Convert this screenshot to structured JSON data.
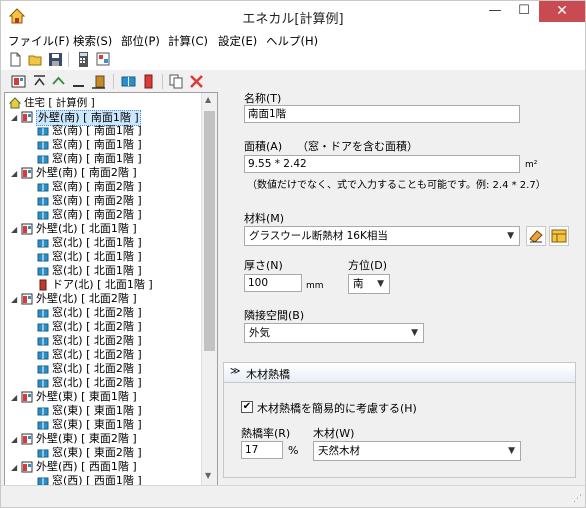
{
  "window": {
    "title": "エネカル[計算例]",
    "min": "—",
    "max": "☐",
    "close": "✕"
  },
  "menu": [
    "ファイル(F)",
    "検索(S)",
    "部位(P)",
    "計算(C)",
    "設定(E)",
    "ヘルプ(H)"
  ],
  "tree": {
    "root": "住宅 [ 計算例 ]",
    "rows": [
      {
        "label": "外壁(南) [ 南面1階 ]",
        "level": 1,
        "kind": "wall",
        "selected": true
      },
      {
        "label": "窓(南) [ 南面1階 ]",
        "level": 2,
        "kind": "window"
      },
      {
        "label": "窓(南) [ 南面1階 ]",
        "level": 2,
        "kind": "window"
      },
      {
        "label": "窓(南) [ 南面1階 ]",
        "level": 2,
        "kind": "window"
      },
      {
        "label": "外壁(南) [ 南面2階 ]",
        "level": 1,
        "kind": "wall"
      },
      {
        "label": "窓(南) [ 南面2階 ]",
        "level": 2,
        "kind": "window"
      },
      {
        "label": "窓(南) [ 南面2階 ]",
        "level": 2,
        "kind": "window"
      },
      {
        "label": "窓(南) [ 南面2階 ]",
        "level": 2,
        "kind": "window"
      },
      {
        "label": "外壁(北) [ 北面1階 ]",
        "level": 1,
        "kind": "wall"
      },
      {
        "label": "窓(北) [ 北面1階 ]",
        "level": 2,
        "kind": "window"
      },
      {
        "label": "窓(北) [ 北面1階 ]",
        "level": 2,
        "kind": "window"
      },
      {
        "label": "窓(北) [ 北面1階 ]",
        "level": 2,
        "kind": "window"
      },
      {
        "label": "ドア(北) [ 北面1階 ]",
        "level": 2,
        "kind": "door"
      },
      {
        "label": "外壁(北) [ 北面2階 ]",
        "level": 1,
        "kind": "wall"
      },
      {
        "label": "窓(北) [ 北面2階 ]",
        "level": 2,
        "kind": "window"
      },
      {
        "label": "窓(北) [ 北面2階 ]",
        "level": 2,
        "kind": "window"
      },
      {
        "label": "窓(北) [ 北面2階 ]",
        "level": 2,
        "kind": "window"
      },
      {
        "label": "窓(北) [ 北面2階 ]",
        "level": 2,
        "kind": "window"
      },
      {
        "label": "窓(北) [ 北面2階 ]",
        "level": 2,
        "kind": "window"
      },
      {
        "label": "窓(北) [ 北面2階 ]",
        "level": 2,
        "kind": "window"
      },
      {
        "label": "外壁(東) [ 東面1階 ]",
        "level": 1,
        "kind": "wall"
      },
      {
        "label": "窓(東) [ 東面1階 ]",
        "level": 2,
        "kind": "window"
      },
      {
        "label": "窓(東) [ 東面1階 ]",
        "level": 2,
        "kind": "window"
      },
      {
        "label": "外壁(東) [ 東面2階 ]",
        "level": 1,
        "kind": "wall"
      },
      {
        "label": "窓(東) [ 東面2階 ]",
        "level": 2,
        "kind": "window"
      },
      {
        "label": "外壁(西) [ 西面1階 ]",
        "level": 1,
        "kind": "wall"
      },
      {
        "label": "窓(西) [ 西面1階 ]",
        "level": 2,
        "kind": "window"
      }
    ]
  },
  "form": {
    "name_label": "名称(T)",
    "name_value": "南面1階",
    "area_label": "面積(A)",
    "area_hint": "（窓・ドアを含む面積）",
    "area_value": "9.55 * 2.42",
    "area_unit": "m²",
    "area_note": "（数値だけでなく、式で入力することも可能です。例: 2.4 * 2.7）",
    "material_label": "材料(M)",
    "material_value": "グラスウール断熱材 16K相当",
    "thickness_label": "厚さ(N)",
    "thickness_value": "100",
    "thickness_unit": "mm",
    "direction_label": "方位(D)",
    "direction_value": "南",
    "adjacent_label": "隣接空間(B)",
    "adjacent_value": "外気"
  },
  "wood_group": {
    "header": "木材熱橋",
    "checkbox_label": "木材熱橋を簡易的に考慮する(H)",
    "checked": true,
    "ratio_label": "熱橋率(R)",
    "ratio_value": "17",
    "ratio_unit": "%",
    "wood_label": "木材(W)",
    "wood_value": "天然木材"
  },
  "colors": {
    "accent_red": "#d93a3a",
    "close_btn": "#c74b50",
    "selection": "#cce8ff",
    "window_icon": "#2a8fc8",
    "door_icon": "#c0392b"
  }
}
